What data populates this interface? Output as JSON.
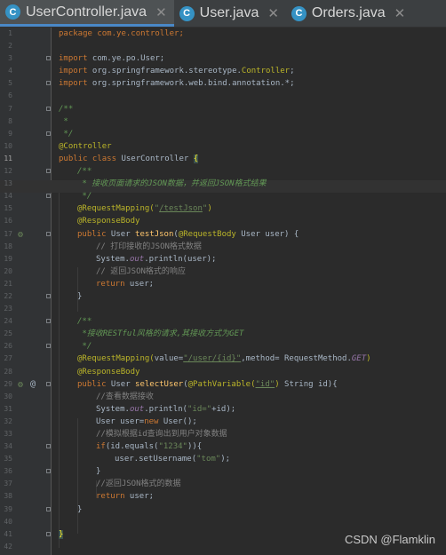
{
  "tabs": [
    {
      "icon": "C",
      "label": "UserController.java",
      "active": true
    },
    {
      "icon": "C",
      "label": "User.java",
      "active": false
    },
    {
      "icon": "C",
      "label": "Orders.java",
      "active": false
    }
  ],
  "close_glyph": "✕",
  "code": {
    "l1": "package com.ye.controller;",
    "l3a": "import",
    "l3b": " com.ye.po.User;",
    "l4a": "import",
    "l4b": " org.springframework.stereotype.",
    "l4c": "Controller",
    "l4d": ";",
    "l5a": "import",
    "l5b": " org.springframework.web.bind.annotation.*;",
    "l7": "/**",
    "l8": " *",
    "l9": " */",
    "l10": "@Controller",
    "l11a": "public class",
    "l11b": " UserController ",
    "l11c": "{",
    "l12": "/**",
    "l13": " * 接收页面请求的JSON数据，并返回JSON格式结果",
    "l14": " */",
    "l15a": "@RequestMapping(",
    "l15b": "\"",
    "l15c": "/testJson",
    "l15d": "\"",
    ")": ")",
    "l16": "@ResponseBody",
    "l17a": "public",
    "l17b": " User ",
    "l17c": "testJson",
    "l17d": "(",
    "l17e": "@RequestBody",
    "l17f": " User user) {",
    "l18": "// 打印接收的JSON格式数据",
    "l19a": "System.",
    "l19b": "out",
    "l19c": ".println(user);",
    "l20": "// 返回JSON格式的响应",
    "l21a": "return",
    "l21b": " user;",
    "l22": "}",
    "l24": "/**",
    "l25": " *接收RESTful风格的请求,其接收方式为GET",
    "l26": " */",
    "l27a": "@RequestMapping(",
    "l27b": "value=",
    "l27c": "\"/user/{id}\"",
    "l27d": ",method= RequestMethod.",
    "l27e": "GET",
    "l27f": ")",
    "l28": "@ResponseBody",
    "l29a": "public",
    "l29b": " User ",
    "l29c": "selectUser",
    "l29d": "(",
    "l29e": "@PathVariable(",
    "l29f": "\"id\"",
    "l29g": ")",
    " l29h": "",
    "l29i": " String id){",
    "l30": "//查看数据接收",
    "l31a": "System.",
    "l31b": "out",
    "l31c": ".println(",
    "l31d": "\"id=\"",
    "l31e": "+id);",
    "l32a": "User user=",
    "l32b": "new",
    "l32c": " User();",
    "l33": "//模拟根据id查询出到用户对象数据",
    "l34a": "if",
    "l34b": "(id.equals(",
    "l34c": "\"1234\"",
    "l34d": ")){",
    "l35a": "user.setUsername(",
    "l35b": "\"tom\"",
    "l35c": ");",
    "l36": "}",
    "l37": "//返回JSON格式的数据",
    "l38a": "return",
    "l38b": " user;",
    "l39": "}",
    "l41": "}"
  },
  "watermark": "CSDN @Flamklin"
}
